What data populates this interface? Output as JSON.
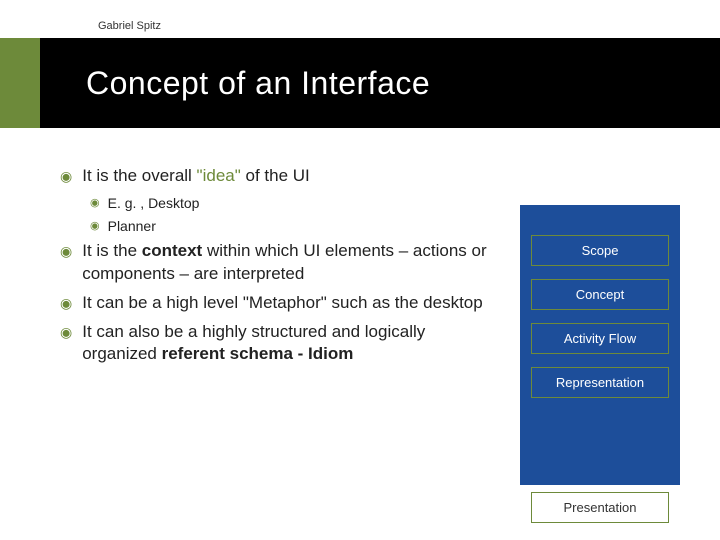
{
  "author": "Gabriel Spitz",
  "title": "Concept of an Interface",
  "bullets": {
    "b1_pre": "It is the overall  ",
    "b1_idea": "\"idea\"",
    "b1_post": " of the UI",
    "b1a": "E. g. , Desktop",
    "b1b": "Planner",
    "b2_pre": "It is the ",
    "b2_context": "context",
    "b2_post": " within which UI elements – actions or components – are interpreted",
    "b3": "It can be a high level \"Metaphor\" such as the desktop",
    "b4_pre": "It can also be a highly structured and logically organized ",
    "b4_ref": "referent schema - Idiom"
  },
  "side": {
    "s1": "Scope",
    "s2": "Concept",
    "s3": "Activity Flow",
    "s4": "Representation",
    "s5": "Presentation"
  }
}
